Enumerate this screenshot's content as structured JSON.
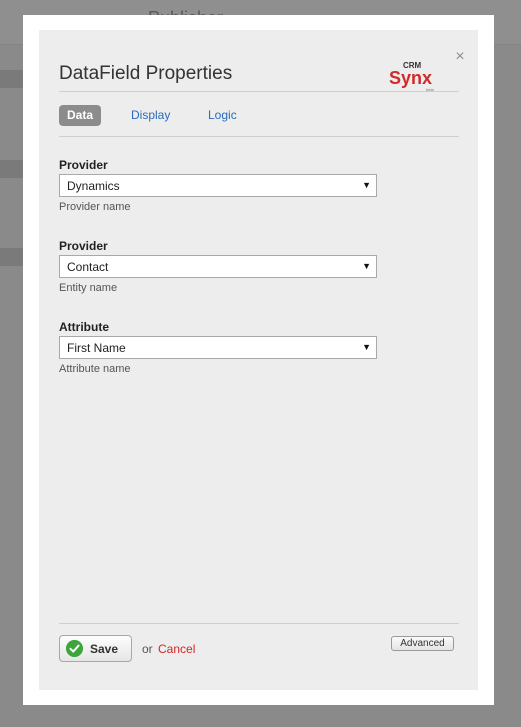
{
  "background": {
    "title_fragment": "Publisher"
  },
  "dialog": {
    "title": "DataField Properties",
    "logo": {
      "top_text": "CRM",
      "main_text": "Synx",
      "sub_text": "beta",
      "color": "#d12a2a"
    },
    "close_icon": "close-icon"
  },
  "tabs": [
    {
      "label": "Data",
      "active": true
    },
    {
      "label": "Display",
      "active": false
    },
    {
      "label": "Logic",
      "active": false
    }
  ],
  "fields": [
    {
      "label": "Provider",
      "value": "Dynamics",
      "help": "Provider name"
    },
    {
      "label": "Provider",
      "value": "Contact",
      "help": "Entity name"
    },
    {
      "label": "Attribute",
      "value": "First Name",
      "help": "Attribute name"
    }
  ],
  "footer": {
    "save_label": "Save",
    "or_text": "or",
    "cancel_label": "Cancel",
    "advanced_label": "Advanced"
  },
  "colors": {
    "accent_link": "#2a6bbd",
    "cancel": "#d62626",
    "save_check": "#3ea53a",
    "active_tab": "#8c8c8c"
  }
}
